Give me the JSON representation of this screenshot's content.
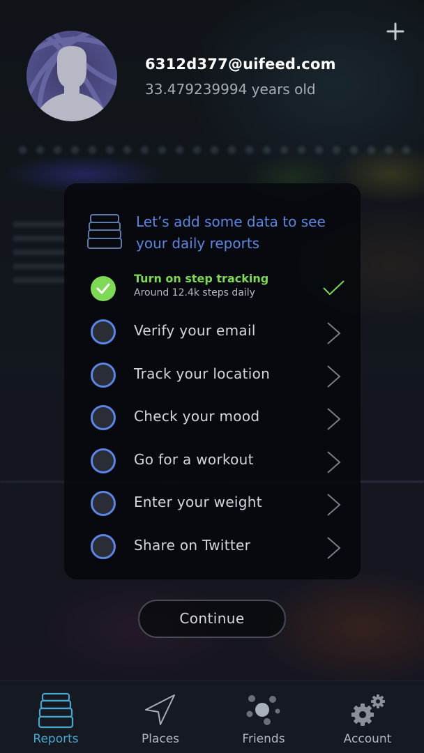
{
  "header": {
    "add_button_icon": "plus-icon",
    "avatar_icon": "default-user-silhouette",
    "email": "6312d377@uifeed.com",
    "age": "33.479239994 years old"
  },
  "onboarding_card": {
    "icon": "stacked-reports-icon",
    "title": "Let’s add some data to see your daily reports",
    "accent_color": "#5d86e0",
    "tasks": [
      {
        "label": "Turn on step tracking",
        "sublabel": "Around 12.4k steps daily",
        "completed": true,
        "trailing_icon": "checkmark-icon"
      },
      {
        "label": "Verify your email",
        "completed": false,
        "trailing_icon": "chevron-right-icon"
      },
      {
        "label": "Track your location",
        "completed": false,
        "trailing_icon": "chevron-right-icon"
      },
      {
        "label": "Check your mood",
        "completed": false,
        "trailing_icon": "chevron-right-icon"
      },
      {
        "label": "Go for a workout",
        "completed": false,
        "trailing_icon": "chevron-right-icon"
      },
      {
        "label": "Enter your weight",
        "completed": false,
        "trailing_icon": "chevron-right-icon"
      },
      {
        "label": "Share on Twitter",
        "completed": false,
        "trailing_icon": "chevron-right-icon"
      }
    ],
    "completed_color": "#7ed957"
  },
  "continue_button": {
    "label": "Continue"
  },
  "tab_bar": {
    "active_color": "#48a6cf",
    "tabs": [
      {
        "label": "Reports",
        "icon": "stacked-reports-icon",
        "active": true
      },
      {
        "label": "Places",
        "icon": "navigation-arrow-icon",
        "active": false
      },
      {
        "label": "Friends",
        "icon": "friends-bubbles-icon",
        "active": false
      },
      {
        "label": "Account",
        "icon": "gears-icon",
        "active": false
      }
    ]
  }
}
